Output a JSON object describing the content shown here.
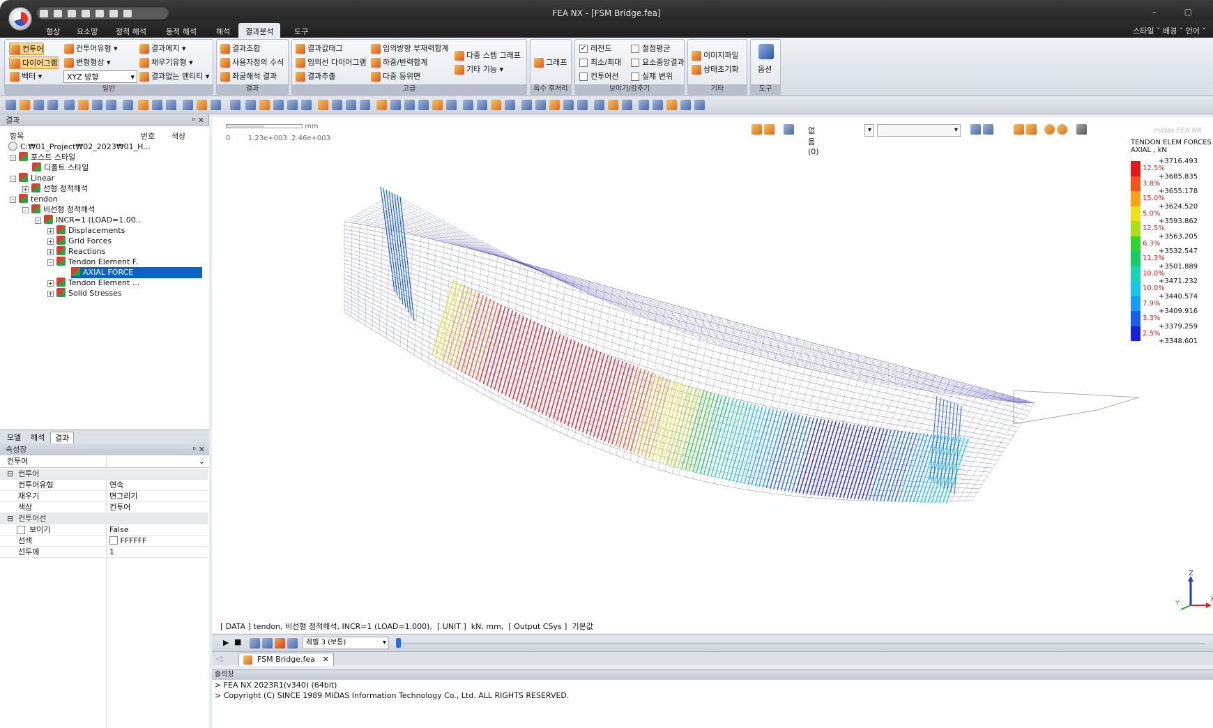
{
  "title": "FEA NX - [FSM Bridge.fea]",
  "tabs": [
    "형상",
    "요소망",
    "정적 해석",
    "동적 해석",
    "해석",
    "결과분석",
    "도구"
  ],
  "tab_right": "스타일 ˅  배경 ˅  언어 ˅",
  "ribbon": {
    "general_label": "일반",
    "contour": "컨투어",
    "diagram": "다이어그램",
    "vector": "벡터",
    "contour_type": "컨투어유형",
    "deform_shape": "변형형상",
    "xyz_dir": "XYZ 방향",
    "result_edge": "결과에지",
    "fill_type": "채우기유형",
    "no_result_entity": "결과없는 엔티티",
    "result_label": "결과",
    "combine": "결과조합",
    "user_formula": "사용자정의 수식",
    "buckling": "좌굴해석 결과",
    "advanced_label": "고급",
    "result_tag": "결과값태그",
    "arb_diagram": "임의선 다이어그램",
    "extract": "결과추출",
    "arb_dir": "임의방향 부재력합계",
    "load_sum": "하중/반력합계",
    "multi_iso": "다중 등위면",
    "multi_step": "다중 스텝 그래프",
    "other_func": "기타 기능",
    "special_label": "특수 후처리",
    "graph": "그래프",
    "view_label": "보이기/감추기",
    "legend": "레전드",
    "minmax": "최소/최대",
    "contour_line": "컨투어선",
    "node_avg": "절점평균",
    "elem_center": "요소중앙결과",
    "real_disp": "실제 변위",
    "etc_label": "기타",
    "image_file": "이미지파일",
    "reset_state": "상태초기화",
    "tool_label": "도구",
    "option": "옵션"
  },
  "tree_panel": {
    "header": "결과",
    "col_item": "항목",
    "col_num": "번호",
    "col_color": "색상",
    "nodes": [
      "C:₩01_Project₩02_2023₩01_H...",
      "포스트 스타일",
      "디폴트 스타일",
      "Linear",
      "선형 정적해석",
      "tendon",
      "비선형 정적해석",
      "INCR=1 (LOAD=1.00..",
      "Displacements",
      "Grid Forces",
      "Reactions",
      "Tendon Element F.",
      "AXIAL FORCE",
      "Tendon Element ...",
      "Solid Stresses"
    ]
  },
  "bottom_tabs": [
    "모델",
    "해석",
    "결과"
  ],
  "props": {
    "header": "속성창",
    "dropdown": "컨투어",
    "cat1": "컨투어",
    "contour_type_k": "컨투어유형",
    "contour_type_v": "연속",
    "fill_k": "채우기",
    "fill_v": "면그리기",
    "color_k": "색상",
    "color_v": "컨투어",
    "cat2": "컨투어선",
    "show_k": "보이기",
    "show_v": "False",
    "linecolor_k": "선색",
    "linecolor_v": "FFFFFF",
    "linewidth_k": "선두께",
    "linewidth_v": "1"
  },
  "viewport": {
    "scale_unit": "mm",
    "scale_labels": "0        1.23e+003  2.46e+003",
    "none_label": "없음 (0)",
    "brand": "midas FEA NX",
    "legend_title1": "TENDON ELEM FORCES",
    "legend_title2": "AXIAL , kN",
    "legend_values": [
      "+3716.493",
      "+3685.835",
      "+3655.178",
      "+3624.520",
      "+3593.862",
      "+3563.205",
      "+3532.547",
      "+3501.889",
      "+3471.232",
      "+3440.574",
      "+3409.916",
      "+3379.259",
      "+3348.601"
    ],
    "legend_pcts": [
      "12.5%",
      "3.8%",
      "15.0%",
      "5.0%",
      "12.5%",
      "6.3%",
      "11.3%",
      "10.0%",
      "10.0%",
      "7.9%",
      "3.3%",
      "2.5%"
    ],
    "legend_colors": [
      "#e31a1c",
      "#f7521a",
      "#f7a21a",
      "#f0e01a",
      "#a8e01a",
      "#32d22a",
      "#18cc6a",
      "#18d6b4",
      "#18c6ec",
      "#189ef0",
      "#1860e8",
      "#1820d8"
    ],
    "status": "[ DATA ] tendon, 비선형 정적해석, INCR=1 (LOAD=1.000),  [ UNIT ]  kN, mm,  [ Output CSys ]  기본값",
    "axis_z": "Z",
    "axis_x": "X",
    "axis_y": "Y"
  },
  "anim": {
    "level": "레벨 3 (보통)"
  },
  "doc_tab": "FSM Bridge.fea",
  "output": {
    "header": "출력창",
    "line1": "> FEA NX 2023R1(v340) (64bit)",
    "line2": "> Copyright (C) SINCE 1989 MIDAS Information Technology Co., Ltd. ALL RIGHTS RESERVED."
  }
}
